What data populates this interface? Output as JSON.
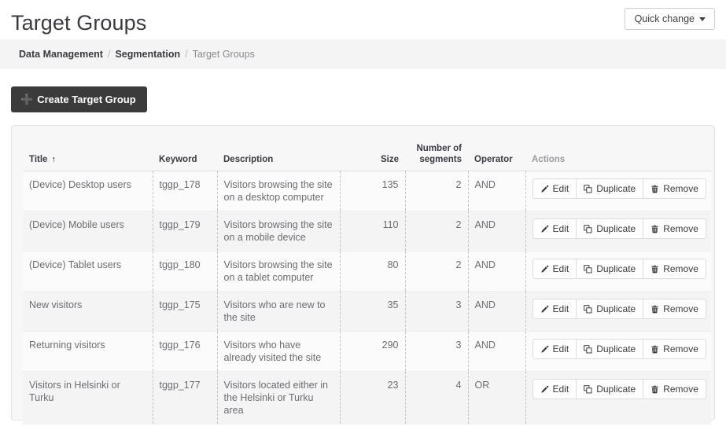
{
  "header": {
    "title": "Target Groups",
    "quick_change_label": "Quick change",
    "caret_icon": "chevron-down-icon"
  },
  "breadcrumb": {
    "items": [
      {
        "label": "Data Management",
        "current": false
      },
      {
        "label": "Segmentation",
        "current": false
      },
      {
        "label": "Target Groups",
        "current": true
      }
    ],
    "separator": "/"
  },
  "toolbar": {
    "create_label": "Create Target Group",
    "create_icon": "plus-icon"
  },
  "table": {
    "columns": [
      {
        "label": "Title",
        "sort": "ascending",
        "sort_icon": "arrow-up-icon"
      },
      {
        "label": "Keyword"
      },
      {
        "label": "Description"
      },
      {
        "label": "Size"
      },
      {
        "label": "Number of segments"
      },
      {
        "label": "Operator"
      },
      {
        "label": "Actions"
      }
    ],
    "column_labels": {
      "title": "Title",
      "keyword": "Keyword",
      "description": "Description",
      "size": "Size",
      "segments_line1": "Number of",
      "segments_line2": "segments",
      "operator": "Operator",
      "actions": "Actions"
    },
    "sort_arrow": "↑",
    "row_actions": {
      "edit_label": "Edit",
      "edit_icon": "pencil-icon",
      "duplicate_label": "Duplicate",
      "duplicate_icon": "copy-icon",
      "remove_label": "Remove",
      "remove_icon": "trash-icon"
    },
    "rows": [
      {
        "title": "(Device) Desktop users",
        "keyword": "tggp_178",
        "description": "Visitors browsing the site on a desktop computer",
        "size": "135",
        "segments": "2",
        "operator": "AND"
      },
      {
        "title": "(Device) Mobile users",
        "keyword": "tggp_179",
        "description": "Visitors browsing the site on a mobile device",
        "size": "110",
        "segments": "2",
        "operator": "AND"
      },
      {
        "title": "(Device) Tablet users",
        "keyword": "tggp_180",
        "description": "Visitors browsing the site on a tablet computer",
        "size": "80",
        "segments": "2",
        "operator": "AND"
      },
      {
        "title": "New visitors",
        "keyword": "tggp_175",
        "description": "Visitors who are new to the site",
        "size": "35",
        "segments": "3",
        "operator": "AND"
      },
      {
        "title": "Returning visitors",
        "keyword": "tggp_176",
        "description": "Visitors who have already visited the site",
        "size": "290",
        "segments": "3",
        "operator": "AND"
      },
      {
        "title": "Visitors in Helsinki or Turku",
        "keyword": "tggp_177",
        "description": "Visitors located either in the Helsinki or Turku area",
        "size": "23",
        "segments": "4",
        "operator": "OR"
      }
    ]
  },
  "colors": {
    "dark_button": "#3b3b3b",
    "panel_bg": "#f7f7f7",
    "breadcrumb_bg": "#f4f4f4",
    "text_muted": "#6c6c72",
    "text_dark": "#3a3a42"
  }
}
